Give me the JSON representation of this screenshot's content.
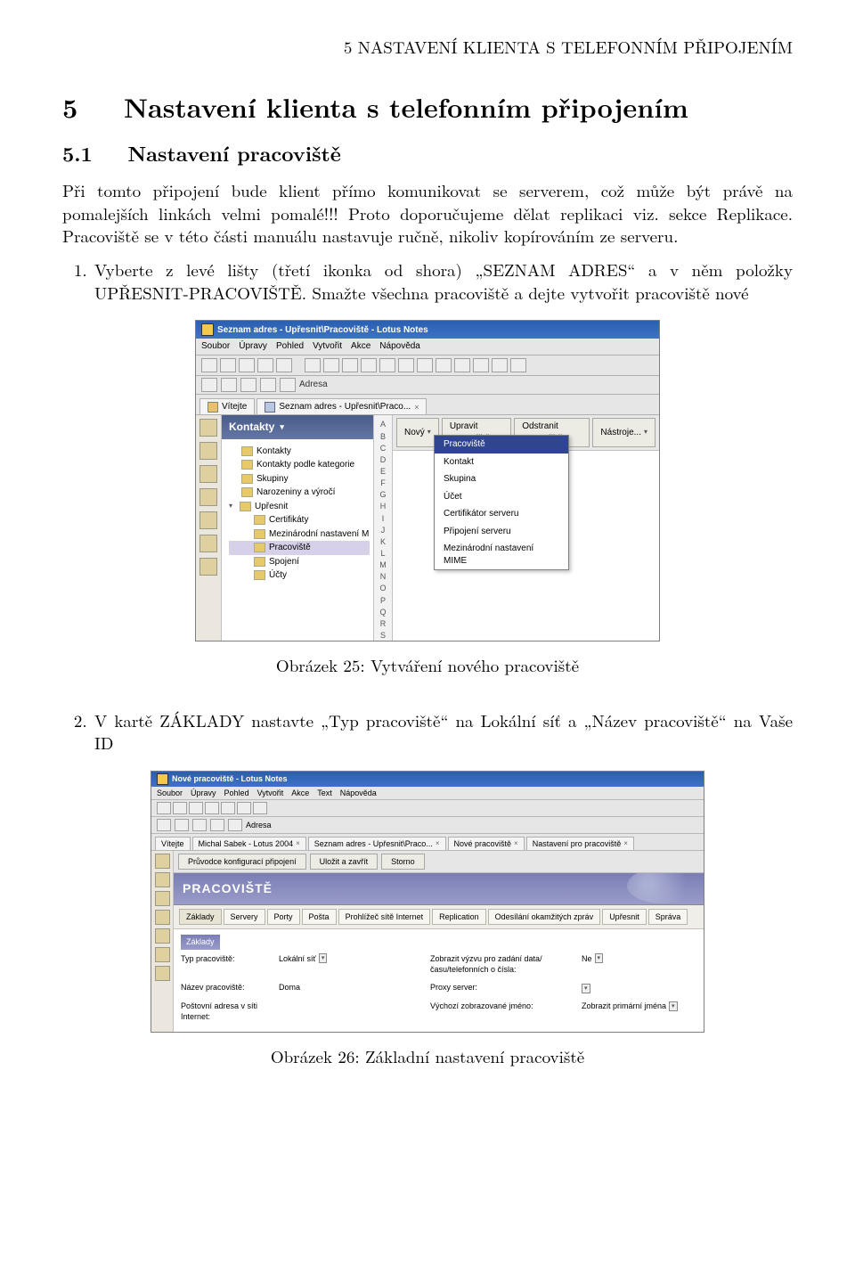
{
  "header": "5  NASTAVENÍ KLIENTA S TELEFONNÍM PŘIPOJENÍM",
  "section": {
    "num": "5",
    "title": "Nastavení klienta s telefonním připojením"
  },
  "subsection": {
    "num": "5.1",
    "title": "Nastavení pracoviště"
  },
  "paragraph": "Při tomto připojení bude klient přímo komunikovat se serverem, což může být právě na pomalejších linkách velmi pomalé!!! Proto doporučujeme dělat replikaci viz. sekce Replikace. Pracoviště se v této části manuálu nastavuje ručně, nikoliv kopírováním ze serveru.",
  "step1": "Vyberte z levé lišty (třetí ikonka od shora) „SEZNAM ADRES“ a v něm položky UPŘESNIT-PRACOVIŠTĚ. Smažte všechna pracoviště a dejte vytvořit pracoviště nové",
  "step2": "V kartě ZÁKLADY nastavte „Typ pracoviště“ na Lokální síť a „Název pracoviště“ na Vaše ID",
  "fig25_caption": "Obrázek 25: Vytváření nového pracoviště",
  "fig26_caption": "Obrázek 26: Základní nastavení pracoviště",
  "shot1": {
    "title": "Seznam adres - Upřesnit\\Pracoviště - Lotus Notes",
    "menubar": [
      "Soubor",
      "Úpravy",
      "Pohled",
      "Vytvořit",
      "Akce",
      "Nápověda"
    ],
    "addr_label": "Adresa",
    "tab1": "Vítejte",
    "tab2": "Seznam adres - Upřesnit\\Praco...",
    "nav_header": "Kontakty",
    "tree": {
      "kontakty": "Kontakty",
      "kontakty_kat": "Kontakty podle kategorie",
      "skupiny": "Skupiny",
      "narozeniny": "Narozeniny a výročí",
      "upresnit": "Upřesnit",
      "certifikaty": "Certifikáty",
      "mezin": "Mezinárodní nastavení M",
      "pracoviste": "Pracoviště",
      "spojeni": "Spojení",
      "ucty": "Účty"
    },
    "letters": [
      "A",
      "B",
      "C",
      "D",
      "E",
      "F",
      "G",
      "H",
      "I",
      "J",
      "K",
      "L",
      "M",
      "N",
      "O",
      "P",
      "Q",
      "R",
      "S"
    ],
    "action_buttons": {
      "novy": "Nový",
      "upravit": "Upravit pracoviště",
      "odstranit": "Odstranit pracoviště",
      "nastroje": "Nástroje..."
    },
    "dropdown": [
      "Pracoviště",
      "Kontakt",
      "Skupina",
      "Účet",
      "Certifikátor serveru",
      "Připojení serveru",
      "Mezinárodní nastavení MIME"
    ]
  },
  "shot2": {
    "title": "Nové pracoviště - Lotus Notes",
    "menubar": [
      "Soubor",
      "Úpravy",
      "Pohled",
      "Vytvořit",
      "Akce",
      "Text",
      "Nápověda"
    ],
    "addr_label": "Adresa",
    "tabs": [
      "Vítejte",
      "Michal Sabek - Lotus 2004",
      "Seznam adres - Upřesnit\\Praco...",
      "Nové pracoviště",
      "Nastavení pro pracoviště"
    ],
    "top_buttons": [
      "Průvodce konfigurací připojení",
      "Uložit a zavřít",
      "Storno"
    ],
    "banner": "PRACOVIŠTĚ",
    "tabs2": [
      "Základy",
      "Servery",
      "Porty",
      "Pošta",
      "Prohlížeč sítě Internet",
      "Replication",
      "Odesílání okamžitých zpráv",
      "Upřesnit",
      "Správa"
    ],
    "section_header": "Základy",
    "rows": {
      "r1l": "Typ pracoviště:",
      "r1v": "Lokální síť",
      "r1r": "Zobrazit výzvu pro zadání data/času/telefonních o čísla:",
      "r1rv": "Ne",
      "r2l": "Název pracoviště:",
      "r2v": "Doma",
      "r2r": "Proxy server:",
      "r3l": "Poštovní adresa v síti Internet:",
      "r3r": "Výchozí zobrazované jméno:",
      "r3rv": "Zobrazit primární jména"
    }
  }
}
